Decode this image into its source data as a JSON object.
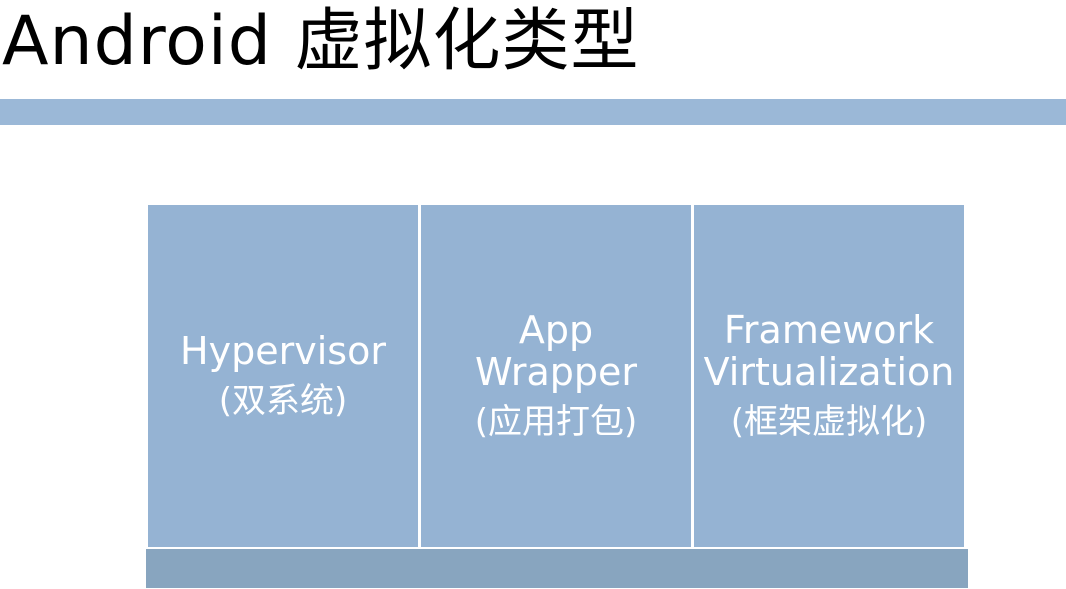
{
  "title": "Android 虚拟化类型",
  "colors": {
    "title_bar": "#9bb8d7",
    "column_fill": "#95b3d3",
    "base_fill": "#88a5bf",
    "separator": "#ffffff",
    "text": "#ffffff"
  },
  "columns": [
    {
      "lines": [
        "Hypervisor"
      ],
      "subtitle": "(双系统)"
    },
    {
      "lines": [
        "App",
        "Wrapper"
      ],
      "subtitle": "(应用打包)"
    },
    {
      "lines": [
        "Framework",
        "Virtualization"
      ],
      "subtitle": "(框架虚拟化)"
    }
  ]
}
